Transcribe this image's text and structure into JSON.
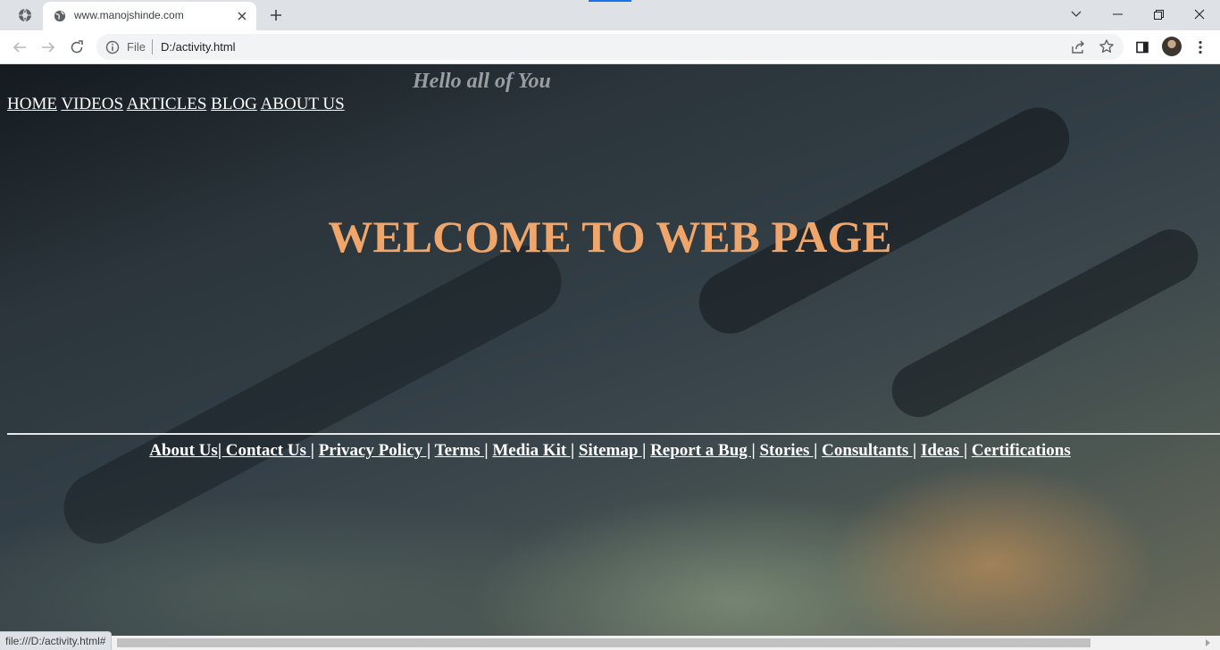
{
  "browser": {
    "tab_title": "www.manojshinde.com",
    "omnibox_scheme": "File",
    "omnibox_url": "D:/activity.html",
    "status_url": "file:///D:/activity.html#"
  },
  "page": {
    "subtitle": "Hello all of You",
    "nav": [
      "HOME",
      "VIDEOS",
      "ARTICLES",
      "BLOG",
      "ABOUT US"
    ],
    "heading": "WELCOME TO WEB PAGE",
    "footer_links": [
      "About Us",
      "| Contact Us |",
      "Privacy Policy |",
      "Terms |",
      "Media Kit |",
      "Sitemap |",
      "Report a Bug |",
      "Stories |",
      "Consultants |",
      "Ideas |",
      "Certifications"
    ]
  },
  "colors": {
    "heading": "#f0a66a",
    "nav_text": "#ffffff",
    "subtitle": "#9a9ea1",
    "tab_accent": "#1a73e8"
  },
  "icons": [
    "tab-search-icon",
    "globe-favicon-icon",
    "close-icon",
    "plus-icon",
    "chevron-down-icon",
    "minimize-icon",
    "restore-icon",
    "window-close-icon",
    "back-arrow-icon",
    "forward-arrow-icon",
    "reload-icon",
    "info-icon",
    "share-icon",
    "star-icon",
    "side-panel-icon",
    "menu-dots-icon"
  ]
}
